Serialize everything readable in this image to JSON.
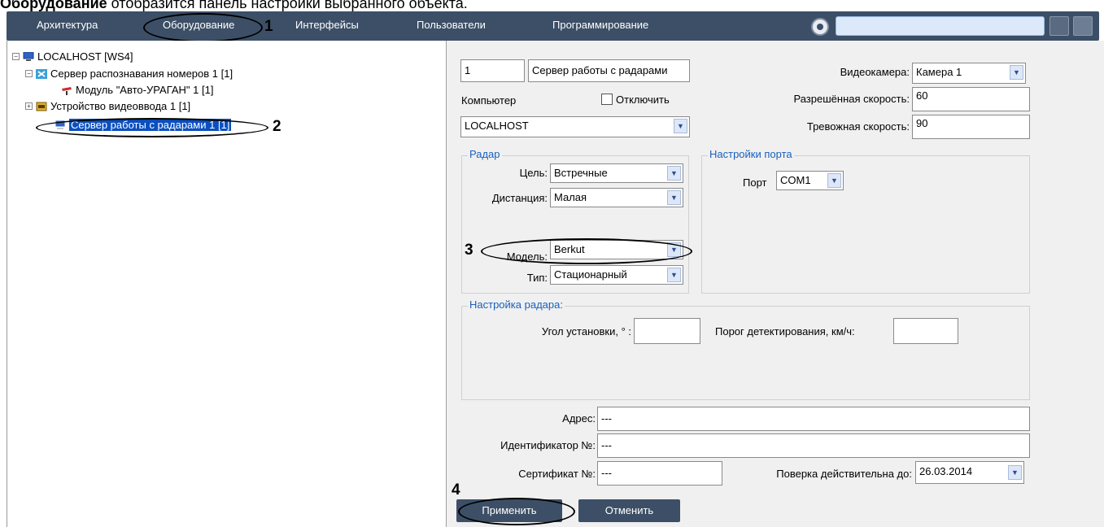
{
  "caption": {
    "bold": "Оборудование",
    "rest": " отобразится панель настройки выбранного объекта."
  },
  "menu": {
    "tabs": [
      "Архитектура",
      "Оборудование",
      "Интерфейсы",
      "Пользователи",
      "Программирование"
    ]
  },
  "annotations": [
    "1",
    "2",
    "3",
    "4"
  ],
  "tree": {
    "root": "LOCALHOST [WS4]",
    "items": [
      {
        "label": "Сервер распознавания номеров 1 [1]"
      },
      {
        "label": "Модуль \"Авто-УРАГАН\" 1 [1]"
      },
      {
        "label": "Устройство видеоввода 1 [1]"
      },
      {
        "label": "Сервер работы с радарами 1 [1]"
      }
    ]
  },
  "panel": {
    "id_value": "1",
    "name_value": "Сервер работы с радарами",
    "computer_label": "Компьютер",
    "disable_label": "Отключить",
    "computer_value": "LOCALHOST",
    "camera_label": "Видеокамера:",
    "camera_value": "Камера 1",
    "allowed_speed_label": "Разрешённая скорость:",
    "allowed_speed_value": "60",
    "alarm_speed_label": "Тревожная скорость:",
    "alarm_speed_value": "90",
    "radar_group": "Радар",
    "target_label": "Цель:",
    "target_value": "Встречные",
    "distance_label": "Дистанция:",
    "distance_value": "Малая",
    "model_label": "Модель:",
    "model_value": "Berkut",
    "type_label": "Тип:",
    "type_value": "Стационарный",
    "port_group": "Настройки порта",
    "port_label": "Порт",
    "port_value": "COM1",
    "radar_setup_group": "Настройка радара:",
    "angle_label": "Угол установки, ° :",
    "angle_value": "",
    "threshold_label": "Порог детектирования, км/ч:",
    "threshold_value": "",
    "address_label": "Адрес:",
    "address_value": "---",
    "identifier_label": "Идентификатор №:",
    "identifier_value": "---",
    "certificate_label": "Сертификат №:",
    "certificate_value": "---",
    "verification_label": "Поверка действительна до:",
    "verification_value": "26.03.2014",
    "apply_button": "Применить",
    "cancel_button": "Отменить"
  },
  "colors": {
    "menu_bg": "#3c4f66",
    "selection": "#0b4fbf",
    "group_title": "#1a5fbf"
  }
}
